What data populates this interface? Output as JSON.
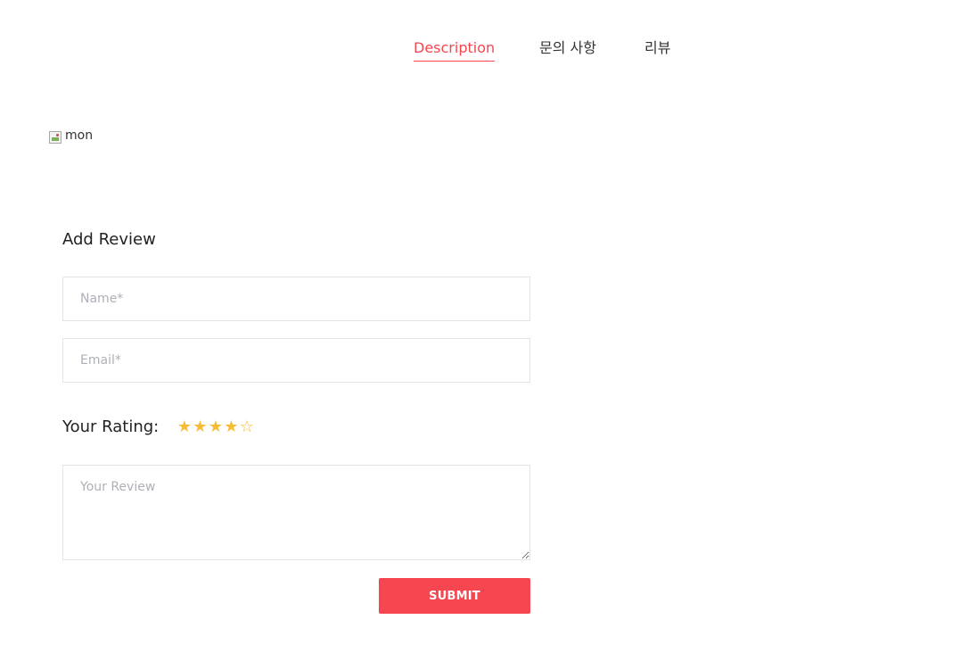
{
  "tabs": [
    {
      "label": "Description",
      "active": true
    },
    {
      "label": "문의 사항",
      "active": false
    },
    {
      "label": "리뷰",
      "active": false
    }
  ],
  "product_image": {
    "alt_text": "mon"
  },
  "review_form": {
    "title": "Add Review",
    "name_placeholder": "Name*",
    "email_placeholder": "Email*",
    "rating_label": "Your Rating:",
    "rating_value": 4,
    "rating_max": 5,
    "review_placeholder": "Your Review",
    "submit_label": "SUBMIT"
  },
  "colors": {
    "accent": "#f6464f",
    "star": "#f7bb35"
  }
}
